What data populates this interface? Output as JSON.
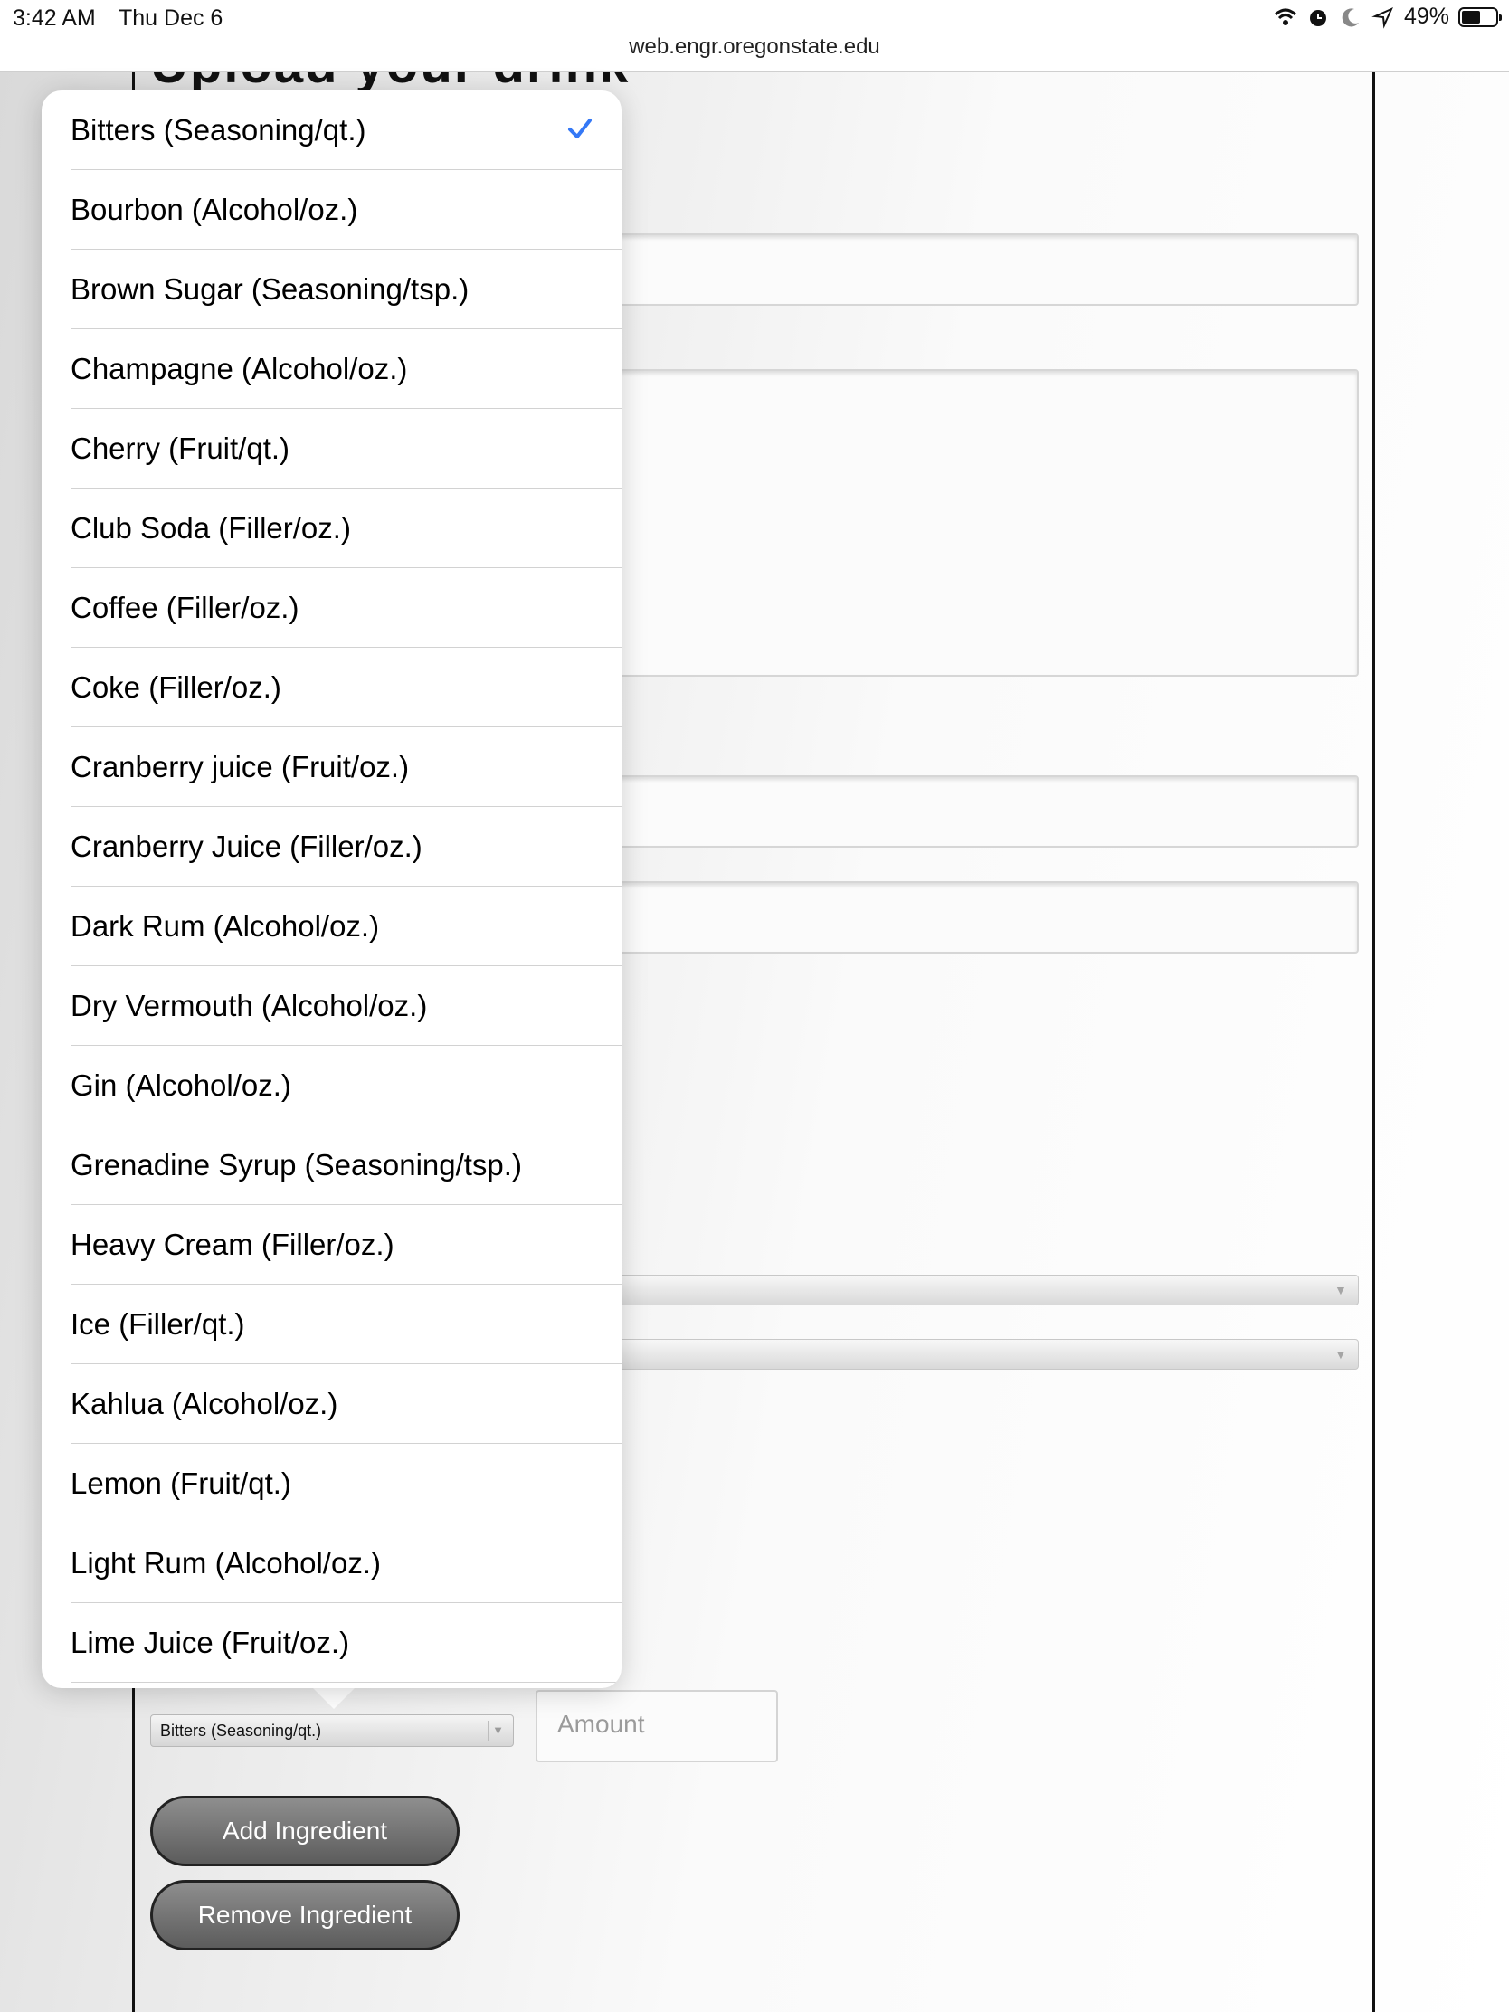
{
  "status_bar": {
    "time": "3:42 AM",
    "date": "Thu Dec 6",
    "battery": "49%"
  },
  "browser": {
    "url": "web.engr.oregonstate.edu"
  },
  "page": {
    "title": "Upload your drink"
  },
  "ingredient_row": {
    "selected": "Bitters (Seasoning/qt.)",
    "amount_placeholder": "Amount"
  },
  "buttons": {
    "add": "Add Ingredient",
    "remove": "Remove Ingredient"
  },
  "dropdown": {
    "selected_index": 0,
    "options": [
      "Bitters (Seasoning/qt.)",
      "Bourbon (Alcohol/oz.)",
      "Brown Sugar (Seasoning/tsp.)",
      "Champagne (Alcohol/oz.)",
      "Cherry (Fruit/qt.)",
      "Club Soda (Filler/oz.)",
      "Coffee (Filler/oz.)",
      "Coke (Filler/oz.)",
      "Cranberry juice (Fruit/oz.)",
      "Cranberry Juice (Filler/oz.)",
      "Dark Rum (Alcohol/oz.)",
      "Dry Vermouth (Alcohol/oz.)",
      "Gin (Alcohol/oz.)",
      "Grenadine Syrup (Seasoning/tsp.)",
      "Heavy Cream (Filler/oz.)",
      "Ice (Filler/qt.)",
      "Kahlua (Alcohol/oz.)",
      "Lemon (Fruit/qt.)",
      "Light Rum (Alcohol/oz.)",
      "Lime Juice (Fruit/oz.)"
    ]
  },
  "colors": {
    "checkmark": "#3478f6",
    "button_gradient_top": "#8e8e8e",
    "button_gradient_bottom": "#5c5c5c"
  },
  "icons": [
    "wifi-icon",
    "alarm-icon",
    "moon-icon",
    "location-icon",
    "battery-icon",
    "checkmark-icon",
    "chevron-down-icon"
  ]
}
